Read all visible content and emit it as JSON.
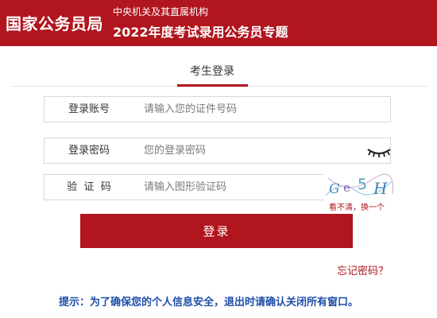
{
  "header": {
    "logo": "国家公务员局",
    "subtitle": "中央机关及其直属机构",
    "title": "2022年度考试录用公务员专题",
    "background_color": "#b1151e"
  },
  "login": {
    "tab_label": "考生登录",
    "account": {
      "label": "登录账号",
      "placeholder": "请输入您的证件号码",
      "value": ""
    },
    "password": {
      "label": "登录密码",
      "placeholder": "您的登录密码",
      "value": "",
      "toggle_icon": "eye-closed-icon"
    },
    "captcha": {
      "label": "验  证  码",
      "placeholder": "请输入图形验证码",
      "value": "",
      "image_text": "Ge5H",
      "refresh_label": "看不清，换一个"
    },
    "submit_label": "登录",
    "forgot_label": "忘记密码？",
    "accent_color": "#b1151e"
  },
  "tip": "提示：为了确保您的个人信息安全，退出时请确认关闭所有窗口。"
}
